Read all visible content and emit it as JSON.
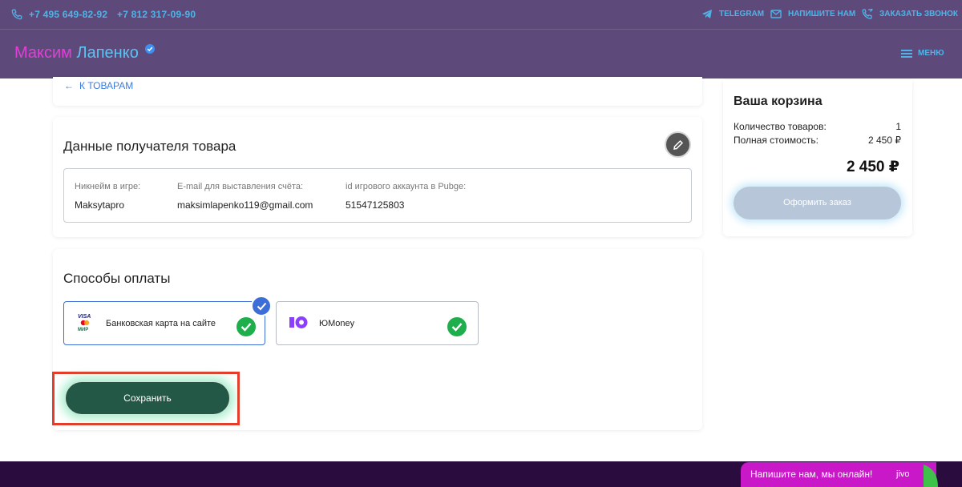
{
  "header": {
    "phones": [
      "+7 495 649-82-92",
      "+7 812 317-09-90"
    ],
    "links": {
      "telegram": "TELEGRAM",
      "write": "НАПИШИТЕ НАМ",
      "callback": "ЗАКАЗАТЬ ЗВОНОК"
    },
    "logo_first": "Максим",
    "logo_last": "Лапенко",
    "menu_label": "МЕНЮ"
  },
  "back_link": "К ТОВАРАМ",
  "recipient": {
    "title": "Данные получателя товара",
    "fields": [
      {
        "label": "Никнейм в игре:",
        "value": "Maksytapro"
      },
      {
        "label": "E-mail для выставления счёта:",
        "value": "maksimlapenko119@gmail.com"
      },
      {
        "label": "id игрового аккаунта в Pubge:",
        "value": "51547125803"
      }
    ]
  },
  "payment": {
    "title": "Способы оплаты",
    "options": [
      {
        "label": "Банковская карта на сайте",
        "selected": true
      },
      {
        "label": "ЮMoney",
        "selected": false
      }
    ],
    "card_logo_text": [
      "VISA",
      "МИР"
    ],
    "save_label": "Сохранить"
  },
  "cart": {
    "title": "Ваша корзина",
    "rows": [
      {
        "label": "Количество товаров:",
        "value": "1"
      },
      {
        "label": "Полная стоимость:",
        "value": "2 450 ₽"
      }
    ],
    "total": "2 450 ₽",
    "checkout_label": "Оформить заказ"
  },
  "chat": {
    "text": "Напишите нам, мы онлайн!",
    "brand": "jivo"
  },
  "colors": {
    "header_bg": "#5e4a7a",
    "accent_blue": "#4fb3e8",
    "save_button": "#235746",
    "selected_border": "#3d6ed8",
    "check_green": "#1fae4c",
    "footer_bg": "#2a0d3e",
    "chat_bg": "#c918c8"
  }
}
